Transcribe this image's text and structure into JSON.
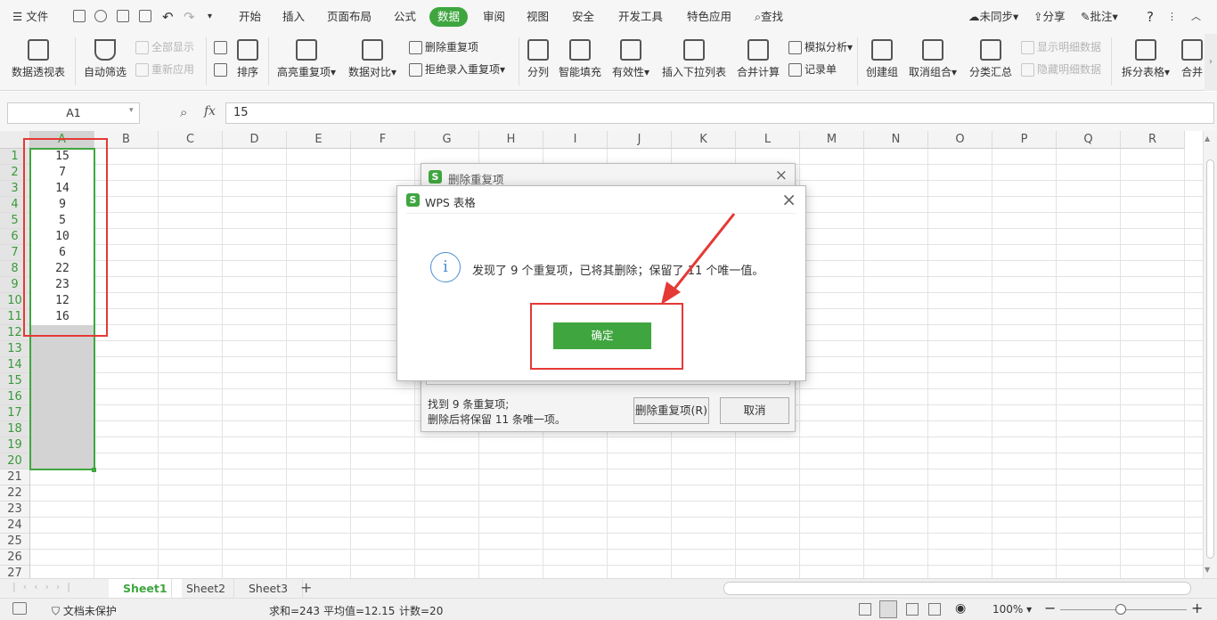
{
  "menubar": {
    "file": "文件",
    "tabs": [
      "开始",
      "插入",
      "页面布局",
      "公式",
      "数据",
      "审阅",
      "视图",
      "安全",
      "开发工具",
      "特色应用"
    ],
    "search": "查找",
    "sync": "未同步",
    "share": "分享",
    "comment": "批注",
    "help": "?"
  },
  "ribbon": {
    "pivot": "数据透视表",
    "autofilter": "自动筛选",
    "show_all": "全部显示",
    "reapply": "重新应用",
    "sort": "排序",
    "highlight_dup": "高亮重复项",
    "compare": "数据对比",
    "remove_dup": "删除重复项",
    "reject_dup": "拒绝录入重复项",
    "split": "分列",
    "smart_fill": "智能填充",
    "validity": "有效性",
    "insert_dropdown": "插入下拉列表",
    "consolidate": "合并计算",
    "simulate": "模拟分析",
    "record": "记录单",
    "group": "创建组",
    "ungroup": "取消组合",
    "subtotal": "分类汇总",
    "show_detail": "显示明细数据",
    "hide_detail": "隐藏明细数据",
    "split_table": "拆分表格",
    "merge": "合并"
  },
  "formula": {
    "cellref": "A1",
    "fx": "fx",
    "value": "15"
  },
  "grid": {
    "columns": [
      "A",
      "B",
      "C",
      "D",
      "E",
      "F",
      "G",
      "H",
      "I",
      "J",
      "K",
      "L",
      "M",
      "N",
      "O",
      "P",
      "Q",
      "R"
    ],
    "rows": [
      "1",
      "2",
      "3",
      "4",
      "5",
      "6",
      "7",
      "8",
      "9",
      "10",
      "11",
      "12",
      "13",
      "14",
      "15",
      "16",
      "17",
      "18",
      "19",
      "20",
      "21",
      "22",
      "23",
      "24",
      "25",
      "26",
      "27"
    ],
    "values": [
      "15",
      "7",
      "14",
      "9",
      "5",
      "10",
      "6",
      "22",
      "23",
      "12",
      "16"
    ]
  },
  "dialog_back": {
    "title": "删除重复项",
    "found": "找到 9 条重复项;",
    "keep": "删除后将保留 11 条唯一项。",
    "remove_btn": "删除重复项(R)",
    "cancel_btn": "取消"
  },
  "dialog_front": {
    "title": "WPS 表格",
    "message": "发现了 9 个重复项，已将其删除；保留了 11 个唯一值。",
    "ok_btn": "确定",
    "info_glyph": "i",
    "close": "×",
    "logo": "S"
  },
  "sheets": {
    "tabs": [
      "Sheet1",
      "Sheet2",
      "Sheet3"
    ],
    "add": "+"
  },
  "status": {
    "protect": "文档未保护",
    "sum": "求和=243",
    "avg": "平均值=12.15",
    "count": "计数=20",
    "zoom": "100%"
  },
  "colors": {
    "accent": "#3fa63f",
    "highlight": "#e53935"
  }
}
